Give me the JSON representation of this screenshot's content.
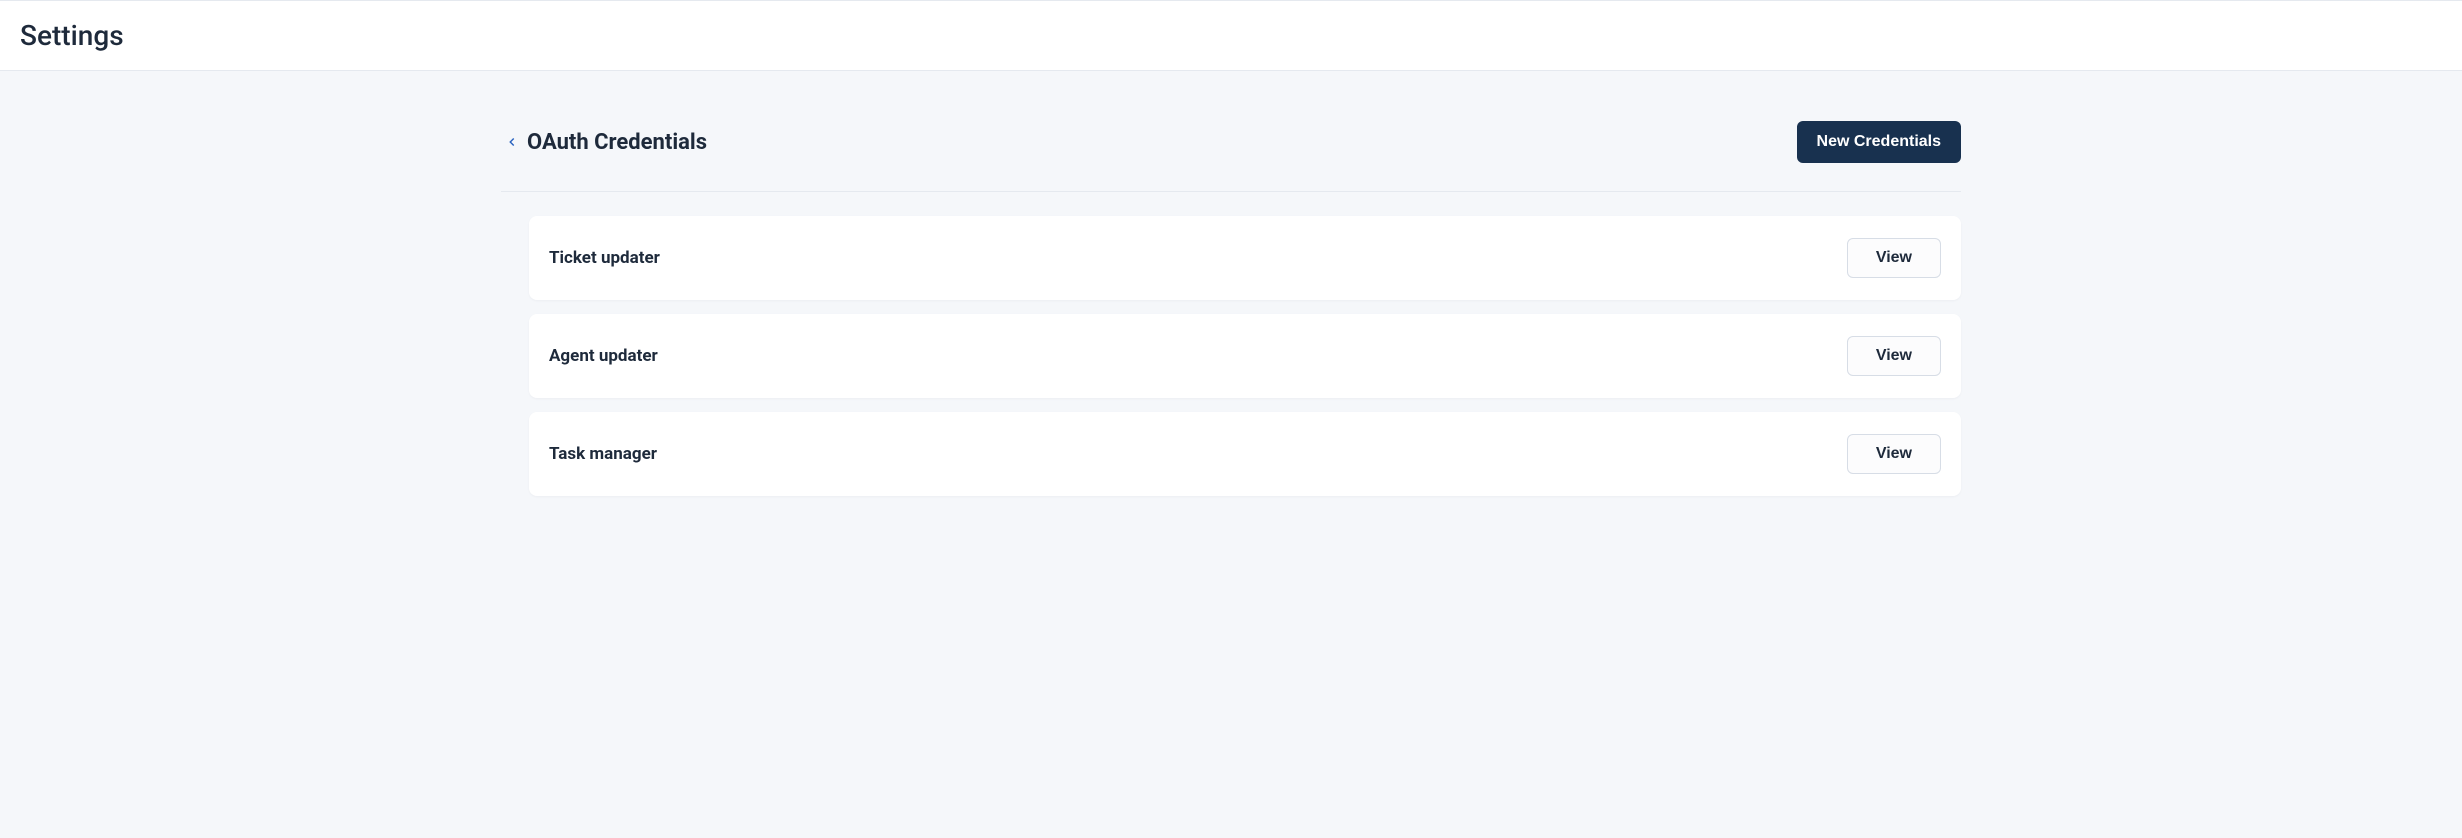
{
  "header": {
    "title": "Settings"
  },
  "section": {
    "title": "OAuth Credentials",
    "new_button_label": "New Credentials"
  },
  "credentials": [
    {
      "name": "Ticket updater",
      "action_label": "View"
    },
    {
      "name": "Agent updater",
      "action_label": "View"
    },
    {
      "name": "Task manager",
      "action_label": "View"
    }
  ]
}
